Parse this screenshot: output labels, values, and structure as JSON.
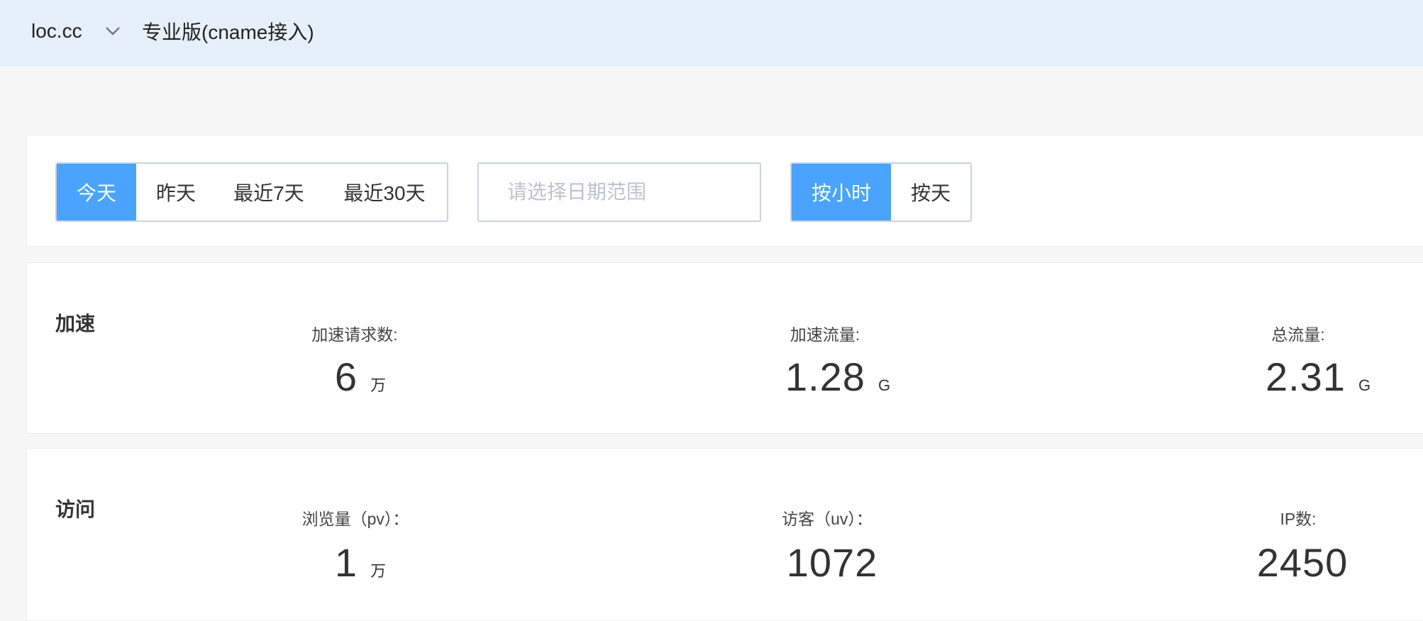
{
  "header": {
    "domain": "loc.cc",
    "domain_chevron_icon": "chevron-down-icon",
    "plan": "专业版(cname接入)"
  },
  "filters": {
    "range_buttons": [
      "今天",
      "昨天",
      "最近7天",
      "最近30天"
    ],
    "range_selected": "今天",
    "date_placeholder": "请选择日期范围",
    "granularity_buttons": [
      "按小时",
      "按天"
    ],
    "granularity_selected": "按小时",
    "accent_color": "#4aa3ff"
  },
  "acceleration": {
    "title": "加速",
    "metrics": [
      {
        "label": "加速请求数:",
        "value": "6",
        "unit": "万"
      },
      {
        "label": "加速流量:",
        "value": "1.28",
        "unit": "G"
      },
      {
        "label": "总流量:",
        "value": "2.31",
        "unit": "G"
      }
    ]
  },
  "visits": {
    "title": "访问",
    "metrics": [
      {
        "label": "浏览量（pv）：",
        "value": "1",
        "unit": "万"
      },
      {
        "label": "访客（uv）：",
        "value": "1072",
        "unit": ""
      },
      {
        "label": "IP数:",
        "value": "2450",
        "unit": ""
      }
    ]
  }
}
